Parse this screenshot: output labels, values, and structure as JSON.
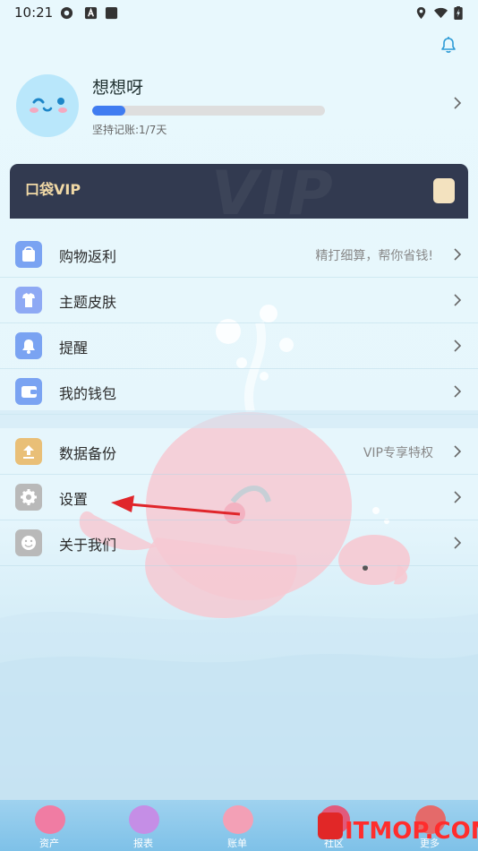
{
  "status_bar": {
    "time": "10:21"
  },
  "profile": {
    "name": "想想呀",
    "streak_text": "坚持记账:1/7天",
    "progress_fraction": 0.143
  },
  "vip": {
    "label": "口袋VIP",
    "background_text": "VIP"
  },
  "menu_group1": [
    {
      "label": "购物返利",
      "hint": "精打细算，帮你省钱!",
      "icon": "bag-icon",
      "color": "#7aa3f2"
    },
    {
      "label": "主题皮肤",
      "hint": "",
      "icon": "shirt-icon",
      "color": "#8ea9f4"
    },
    {
      "label": "提醒",
      "hint": "",
      "icon": "bell-icon",
      "color": "#7aa3f2"
    },
    {
      "label": "我的钱包",
      "hint": "",
      "icon": "wallet-icon",
      "color": "#7aa3f2"
    }
  ],
  "menu_group2": [
    {
      "label": "数据备份",
      "hint": "VIP专享特权",
      "icon": "upload-icon",
      "color": "#e9bf77"
    },
    {
      "label": "设置",
      "hint": "",
      "icon": "gear-icon",
      "color": "#b9b9b9"
    },
    {
      "label": "关于我们",
      "hint": "",
      "icon": "smile-icon",
      "color": "#b9b9b9"
    }
  ],
  "tabs": [
    {
      "label": "资产",
      "icon": "shell-icon",
      "color": "#f07ca3"
    },
    {
      "label": "报表",
      "icon": "coral-icon",
      "color": "#c58ee6"
    },
    {
      "label": "账单",
      "icon": "crab-icon",
      "color": "#f3a0b6"
    },
    {
      "label": "社区",
      "icon": "house-icon",
      "color": "#e15a7c"
    },
    {
      "label": "更多",
      "icon": "balloon-icon",
      "color": "#e46a6a"
    }
  ],
  "watermark": "ITMOP.COM",
  "colors": {
    "accent": "#3f7cf1",
    "vip_bg": "#323a50",
    "vip_text": "#f1d9a6"
  }
}
